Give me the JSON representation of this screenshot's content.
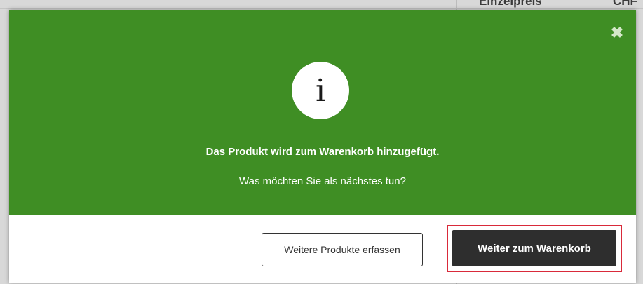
{
  "background": {
    "column_header": "Einzelpreis",
    "currency_fragment": "CHF"
  },
  "modal": {
    "close_glyph": "✖",
    "info_glyph": "i",
    "title": "Das Produkt wird zum Warenkorb hinzugefügt.",
    "subtitle": "Was möchten Sie als nächstes tun?",
    "continue_shopping_label": "Weitere Produkte erfassen",
    "go_to_cart_label": "Weiter zum Warenkorb"
  },
  "colors": {
    "header_green": "#3f8e24",
    "primary_button": "#2e2e2e",
    "highlight_red": "#d92a3a"
  }
}
